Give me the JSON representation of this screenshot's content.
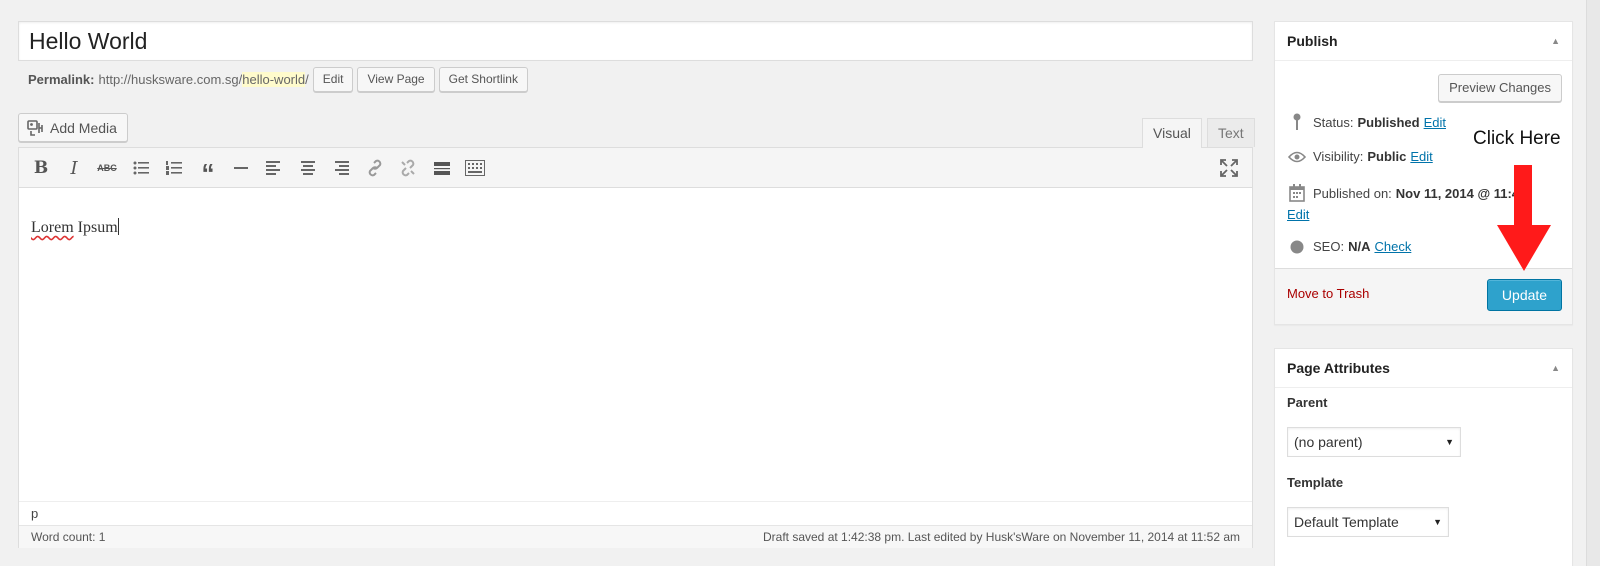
{
  "post": {
    "title": "Hello World",
    "permalink_label": "Permalink:",
    "permalink_base": "http://husksware.com.sg/",
    "permalink_slug": "hello-world",
    "permalink_trail": "/",
    "edit_label": "Edit",
    "view_label": "View Page",
    "shortlink_label": "Get Shortlink"
  },
  "editor": {
    "add_media_label": "Add Media",
    "tab_visual": "Visual",
    "tab_text": "Text",
    "toolbar": [
      "bold-icon",
      "italic-icon",
      "strikethrough-icon",
      "bullet-list-icon",
      "numbered-list-icon",
      "blockquote-icon",
      "horizontal-rule-icon",
      "align-left-icon",
      "align-center-icon",
      "align-right-icon",
      "insert-link-icon",
      "remove-link-icon",
      "read-more-icon",
      "toolbar-toggle-icon",
      "fullscreen-icon"
    ],
    "content_word": "Lorem",
    "content_rest": " Ipsum",
    "path": "p",
    "word_count": "Word count: 1",
    "draft_status": "Draft saved at 1:42:38 pm. Last edited by Husk'sWare on November 11, 2014 at 11:52 am"
  },
  "publish": {
    "heading": "Publish",
    "preview_label": "Preview Changes",
    "status_label": "Status:",
    "status_value": "Published",
    "visibility_label": "Visibility:",
    "visibility_value": "Public",
    "published_label": "Published on:",
    "published_value": "Nov 11, 2014 @ 11:49",
    "seo_label": "SEO:",
    "seo_value": "N/A",
    "edit_link": "Edit",
    "check_link": "Check",
    "trash_label": "Move to Trash",
    "update_label": "Update"
  },
  "attributes": {
    "heading": "Page Attributes",
    "parent_label": "Parent",
    "parent_value": "(no parent)",
    "template_label": "Template",
    "template_value": "Default Template"
  },
  "annotation": {
    "text": "Click Here",
    "color": "#ff1a1a"
  }
}
